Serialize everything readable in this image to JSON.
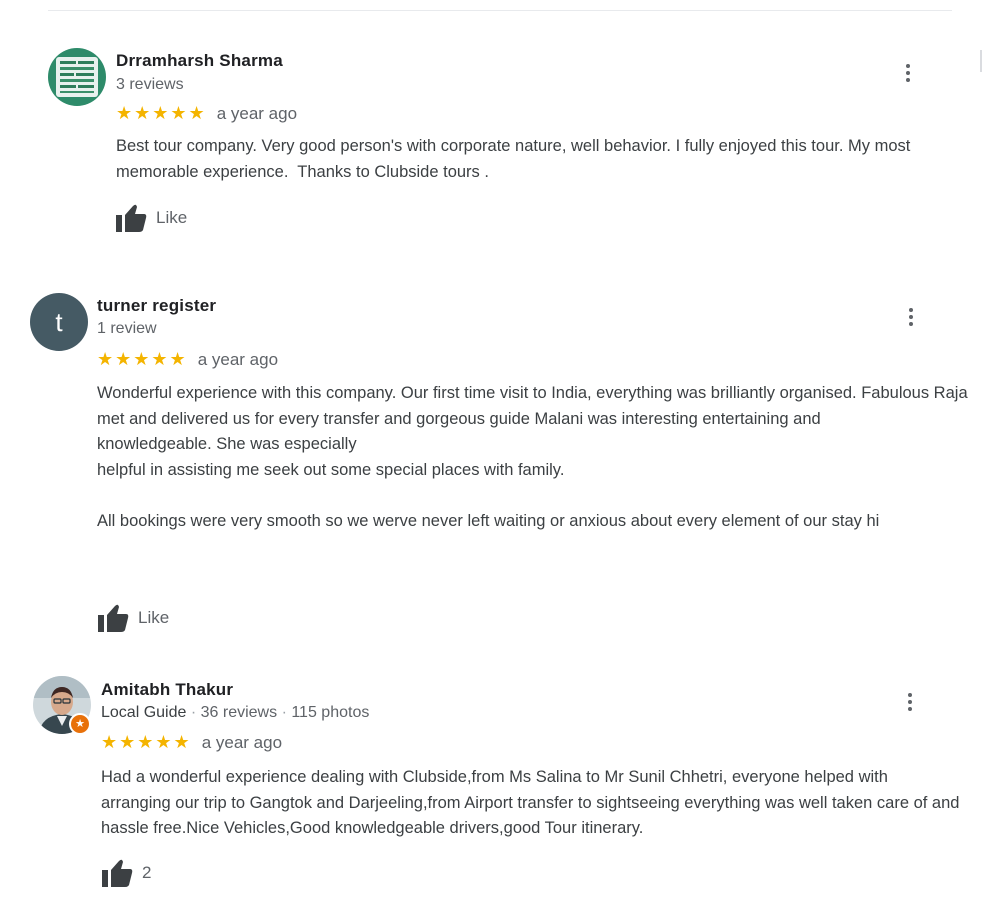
{
  "reviews": [
    {
      "name": "Drramharsh Sharma",
      "meta": "3 reviews",
      "stars": "★★★★★",
      "rating": 5,
      "date": "a year ago",
      "paragraphs": [
        "Best tour company. Very good person's with corporate nature, well behavior. I fully enjoyed this tour. My most memorable experience.  Thanks to Clubside tours ."
      ],
      "like_label": "Like"
    },
    {
      "name": "turner register",
      "avatar_letter": "t",
      "meta": "1 review",
      "stars": "★★★★★",
      "rating": 5,
      "date": "a year ago",
      "paragraphs": [
        "Wonderful experience with this company. Our first time visit to India, everything was brilliantly organised. Fabulous Raja met and delivered us for every transfer and gorgeous guide Malani was interesting entertaining and",
        "knowledgeable. She was especially",
        "helpful in assisting me seek out some special places with family.",
        "",
        "All bookings were very smooth so we werve never left waiting or anxious about every element of our stay hi"
      ],
      "like_label": "Like"
    },
    {
      "name": "Amitabh Thakur",
      "meta_guide": "Local Guide",
      "meta_reviews": "36 reviews",
      "meta_photos": "115 photos",
      "meta_sep": "·",
      "stars": "★★★★★",
      "rating": 5,
      "date": "a year ago",
      "paragraphs": [
        "Had a wonderful experience dealing with Clubside,from Ms Salina to Mr Sunil Chhetri, everyone helped with arranging our trip to Gangtok and Darjeeling,from Airport transfer to sightseeing everything was well taken care of and hassle free.Nice Vehicles,Good knowledgeable drivers,good Tour itinerary."
      ],
      "like_count": "2"
    }
  ],
  "colors": {
    "star": "#f4b400",
    "name": "#202124",
    "secondary": "#5f6368",
    "avatar_letter_bg": "#455a64",
    "guide_badge": "#e8710a"
  },
  "icons": {
    "like": "thumbs-up-icon",
    "more": "more-vert-icon"
  }
}
